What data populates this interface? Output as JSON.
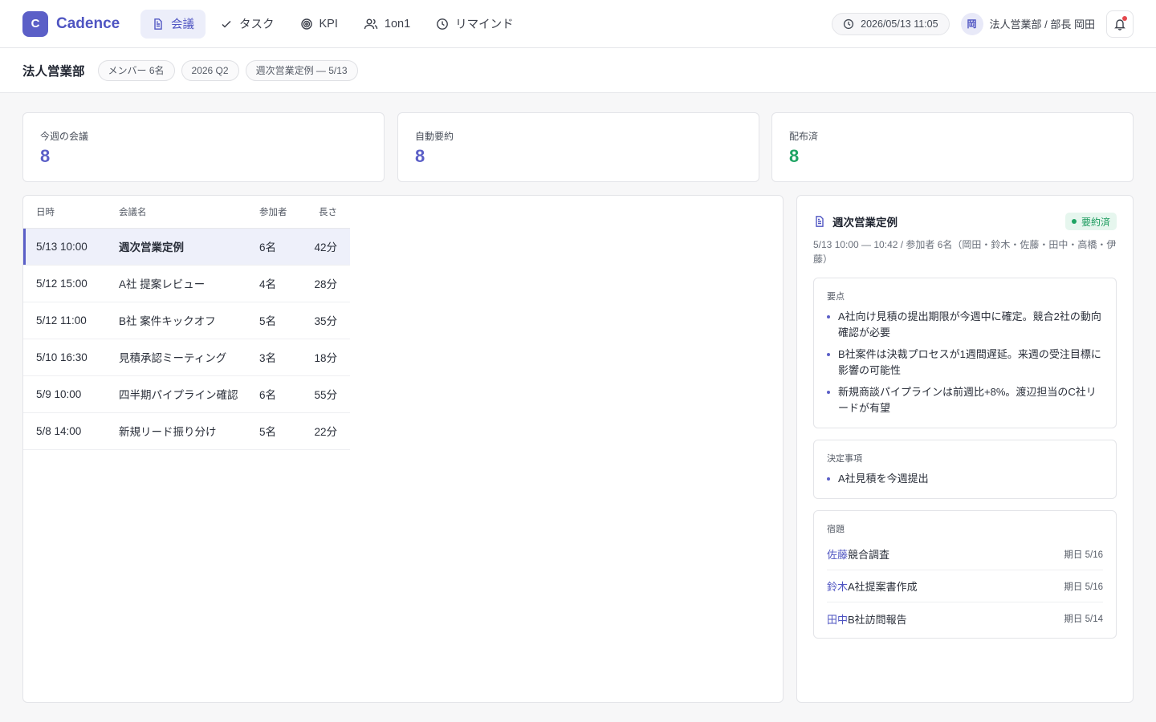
{
  "app": {
    "logo_letter": "C",
    "name": "Cadence"
  },
  "nav": [
    {
      "label": "会議",
      "icon": "document-icon",
      "active": true
    },
    {
      "label": "タスク",
      "icon": "check-icon"
    },
    {
      "label": "KPI",
      "icon": "target-icon"
    },
    {
      "label": "1on1",
      "icon": "users-icon"
    },
    {
      "label": "リマインド",
      "icon": "clock-icon"
    }
  ],
  "header": {
    "datetime": "2026/05/13 11:05",
    "user_initial": "岡",
    "user_label": "法人営業部 / 部長 岡田"
  },
  "subheader": {
    "dept": "法人営業部",
    "members": "メンバー 6名",
    "period": "2026 Q2",
    "current_meeting": "週次営業定例 — 5/13"
  },
  "stats": [
    {
      "label": "今週の会議",
      "value": "8",
      "color": "#5b5fc7"
    },
    {
      "label": "自動要約",
      "value": "8",
      "color": "#5b5fc7"
    },
    {
      "label": "配布済",
      "value": "8",
      "color": "#1fa463"
    }
  ],
  "table": {
    "headers": {
      "date": "日時",
      "name": "会議名",
      "participants": "参加者",
      "length": "長さ"
    },
    "rows": [
      {
        "date": "5/13 10:00",
        "name": "週次営業定例",
        "participants": "6名",
        "length": "42分",
        "selected": true
      },
      {
        "date": "5/12 15:00",
        "name": "A社 提案レビュー",
        "participants": "4名",
        "length": "28分"
      },
      {
        "date": "5/12 11:00",
        "name": "B社 案件キックオフ",
        "participants": "5名",
        "length": "35分"
      },
      {
        "date": "5/10 16:30",
        "name": "見積承認ミーティング",
        "participants": "3名",
        "length": "18分"
      },
      {
        "date": "5/9 10:00",
        "name": "四半期パイプライン確認",
        "participants": "6名",
        "length": "55分"
      },
      {
        "date": "5/8 14:00",
        "name": "新規リード振り分け",
        "participants": "5名",
        "length": "22分"
      }
    ]
  },
  "detail": {
    "title": "週次営業定例",
    "status": "要約済",
    "meta": "5/13 10:00 — 10:42 / 参加者 6名（岡田・鈴木・佐藤・田中・高橋・伊藤）",
    "points_title": "要点",
    "points": [
      "A社向け見積の提出期限が今週中に確定。競合2社の動向確認が必要",
      "B社案件は決裁プロセスが1週間遅延。来週の受注目標に影響の可能性",
      "新規商談パイプラインは前週比+8%。渡辺担当のC社リードが有望"
    ],
    "decisions_title": "決定事項",
    "decisions": [
      "A社見積を今週提出"
    ],
    "tasks_title": "宿題",
    "tasks": [
      {
        "owner": "佐藤",
        "task": "競合調査",
        "due": "期日 5/16"
      },
      {
        "owner": "鈴木",
        "task": "A社提案書作成",
        "due": "期日 5/16"
      },
      {
        "owner": "田中",
        "task": "B社訪問報告",
        "due": "期日 5/14"
      }
    ]
  }
}
